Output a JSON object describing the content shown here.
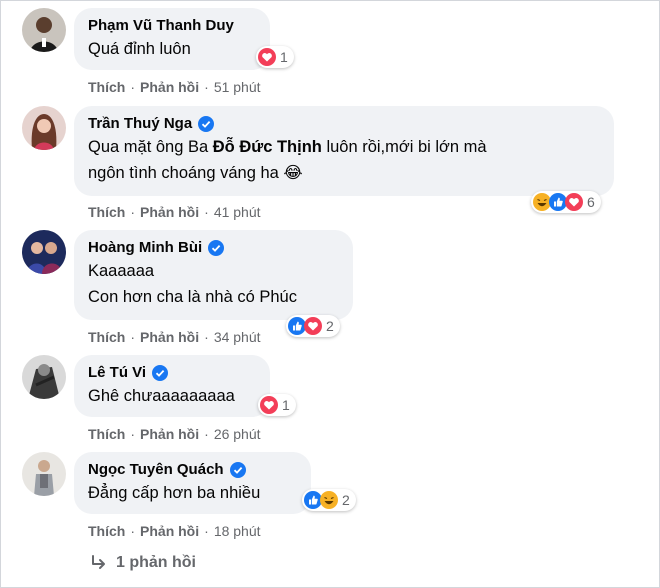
{
  "comments": [
    {
      "author": "Phạm Vũ Thanh Duy",
      "verified": false,
      "text": "Quá đỉnh luôn",
      "reactions": [
        "love"
      ],
      "reaction_count": "1",
      "like_label": "Thích",
      "reply_label": "Phản hồi",
      "time": "51 phút"
    },
    {
      "author": "Trần Thuý Nga",
      "verified": true,
      "text_before": "Qua mặt ông Ba ",
      "text_bold": "Đỗ Đức Thịnh",
      "text_after": " luôn rồi,mới bi lớn mà\nngôn tình choáng váng ha 😂",
      "reactions": [
        "haha",
        "like",
        "love"
      ],
      "reaction_count": "6",
      "like_label": "Thích",
      "reply_label": "Phản hồi",
      "time": "41 phút"
    },
    {
      "author": "Hoàng Minh Bùi",
      "verified": true,
      "text": "Kaaaaaa\nCon hơn cha là nhà có Phúc",
      "reactions": [
        "like",
        "love"
      ],
      "reaction_count": "2",
      "like_label": "Thích",
      "reply_label": "Phản hồi",
      "time": "34 phút"
    },
    {
      "author": "Lê Tú Vi",
      "verified": true,
      "text": "Ghê chưaaaaaaaaa",
      "reactions": [
        "love"
      ],
      "reaction_count": "1",
      "like_label": "Thích",
      "reply_label": "Phản hồi",
      "time": "26 phút"
    },
    {
      "author": "Ngọc Tuyên Quách",
      "verified": true,
      "text": "Đẳng cấp hơn ba nhiều",
      "reactions": [
        "like",
        "haha"
      ],
      "reaction_count": "2",
      "like_label": "Thích",
      "reply_label": "Phản hồi",
      "time": "18 phút"
    }
  ],
  "replies_label": "1 phản hồi",
  "colors": {
    "bubble": "#f0f2f5",
    "meta": "#65676b",
    "verified": "#1877f2",
    "like": "#1877f2",
    "love": "#f33e58",
    "haha": "#f7b125"
  }
}
